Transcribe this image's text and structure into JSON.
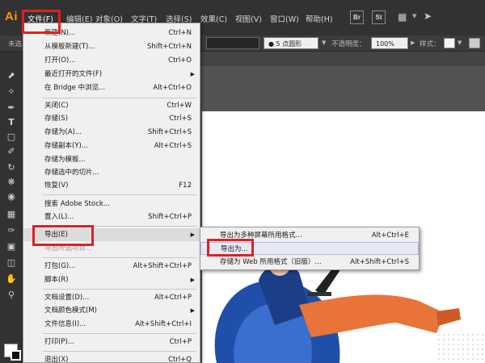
{
  "app": {
    "logo": "Ai"
  },
  "menubar": {
    "items": [
      "文件(F)",
      "编辑(E)",
      "对象(O)",
      "文字(T)",
      "选择(S)",
      "效果(C)",
      "视图(V)",
      "窗口(W)",
      "帮助(H)"
    ],
    "bridge_label": "Br",
    "stock_label": "St",
    "icons": [
      "workspace-grid-icon",
      "rocket-icon"
    ]
  },
  "controlbar": {
    "left_label": "未选",
    "brush_label": "5 点圆形",
    "opacity_label": "不透明度：",
    "opacity_value": "100%",
    "style_label": "样式："
  },
  "file_menu": {
    "groups": [
      [
        {
          "label": "新建(N)...",
          "shortcut": "Ctrl+N"
        },
        {
          "label": "从模板新建(T)...",
          "shortcut": "Shift+Ctrl+N"
        },
        {
          "label": "打开(O)...",
          "shortcut": "Ctrl+O"
        },
        {
          "label": "最近打开的文件(F)",
          "shortcut": "",
          "submenu": true
        },
        {
          "label": "在 Bridge 中浏览...",
          "shortcut": "Alt+Ctrl+O"
        }
      ],
      [
        {
          "label": "关闭(C)",
          "shortcut": "Ctrl+W"
        },
        {
          "label": "存储(S)",
          "shortcut": "Ctrl+S"
        },
        {
          "label": "存储为(A)...",
          "shortcut": "Shift+Ctrl+S"
        },
        {
          "label": "存储副本(Y)...",
          "shortcut": "Alt+Ctrl+S"
        },
        {
          "label": "存储为模板...",
          "shortcut": ""
        },
        {
          "label": "存储选中的切片...",
          "shortcut": ""
        },
        {
          "label": "恢复(V)",
          "shortcut": "F12"
        }
      ],
      [
        {
          "label": "搜索 Adobe Stock...",
          "shortcut": ""
        },
        {
          "label": "置入(L)...",
          "shortcut": "Shift+Ctrl+P"
        }
      ],
      [
        {
          "label": "导出(E)",
          "shortcut": "",
          "submenu": true,
          "highlighted": true
        },
        {
          "label": "导出所选项目...",
          "shortcut": "",
          "disabled": true
        }
      ],
      [
        {
          "label": "打包(G)...",
          "shortcut": "Alt+Shift+Ctrl+P"
        },
        {
          "label": "脚本(R)",
          "shortcut": "",
          "submenu": true
        }
      ],
      [
        {
          "label": "文档设置(D)...",
          "shortcut": "Alt+Ctrl+P"
        },
        {
          "label": "文档颜色模式(M)",
          "shortcut": "",
          "submenu": true
        },
        {
          "label": "文件信息(I)...",
          "shortcut": "Alt+Shift+Ctrl+I"
        }
      ],
      [
        {
          "label": "打印(P)...",
          "shortcut": "Ctrl+P"
        }
      ],
      [
        {
          "label": "退出(X)",
          "shortcut": "Ctrl+Q"
        }
      ]
    ]
  },
  "export_menu": {
    "items": [
      {
        "label": "导出为多种屏幕所用格式...",
        "shortcut": "Alt+Ctrl+E"
      },
      {
        "label": "导出为...",
        "shortcut": "",
        "hover": true
      },
      {
        "label": "存储为 Web 所用格式（旧版）...",
        "shortcut": "Alt+Shift+Ctrl+S"
      }
    ]
  },
  "colors": {
    "highlight_frame": "#e02020",
    "menubar_bg": "#323232",
    "menu_bg": "#f0f0f0",
    "illustration_blue": "#1f4fa8",
    "illustration_orange": "#e8743a"
  }
}
